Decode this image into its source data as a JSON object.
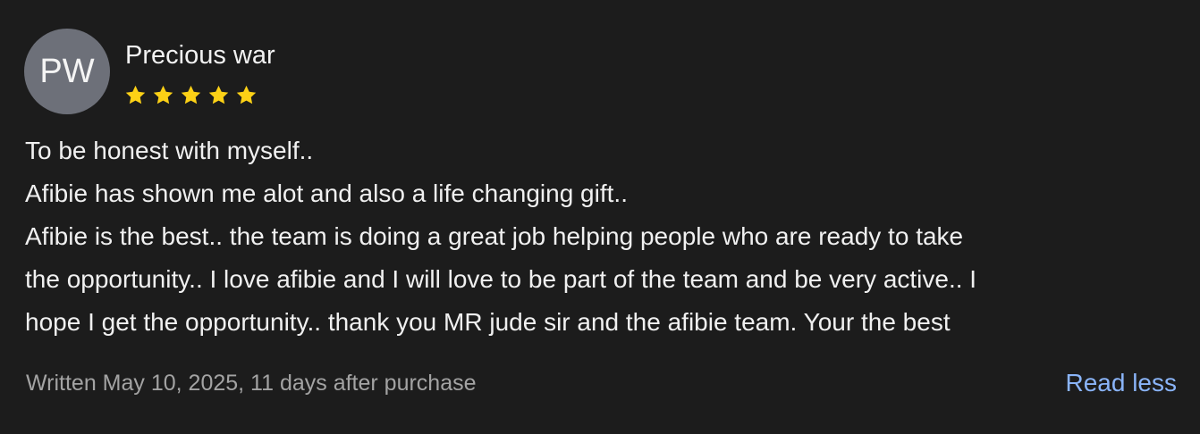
{
  "review": {
    "avatar_initials": "PW",
    "author": "Precious war",
    "rating": 5,
    "rating_max": 5,
    "star_color": "#fcd116",
    "body_lines": [
      "To be honest with myself..",
      "Afibie has shown me alot and also a life changing gift..",
      "Afibie is the best.. the team is doing a great job helping people who are ready to take",
      "the opportunity.. I love afibie and I will love to be part of the team and be very active.. I",
      "hope I get the opportunity.. thank you MR jude sir and the afibie team. Your the best"
    ],
    "meta": "Written May 10, 2025, 11 days after purchase",
    "toggle_label": "Read less"
  },
  "colors": {
    "background": "#1c1c1c",
    "avatar_bg": "#6d7079",
    "link": "#8ab4f8",
    "muted_text": "#a3a3a3"
  },
  "icons": [
    "star-icon"
  ]
}
